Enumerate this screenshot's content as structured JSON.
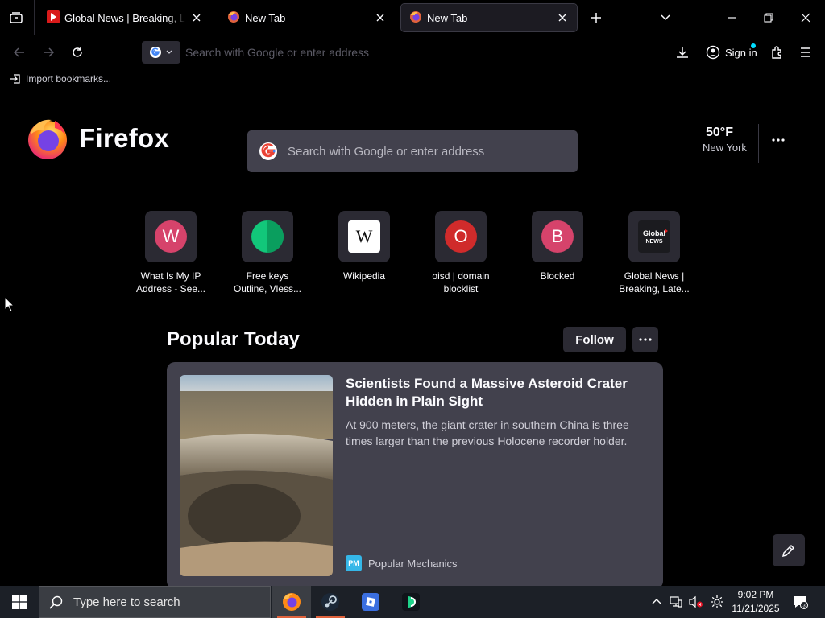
{
  "tabs": [
    {
      "title": "Global News | Breaking, Latest News",
      "selected": false,
      "favicon": "global-news-favicon"
    },
    {
      "title": "New Tab",
      "selected": false,
      "favicon": "firefox-favicon"
    },
    {
      "title": "New Tab",
      "selected": true,
      "favicon": "firefox-favicon"
    }
  ],
  "navbar": {
    "url_placeholder": "Search with Google or enter address",
    "sign_in_label": "Sign in"
  },
  "bookmarks": {
    "import_label": "Import bookmarks..."
  },
  "newtab": {
    "brand": "Firefox",
    "search_placeholder": "Search with Google or enter address",
    "weather": {
      "temp": "50°F",
      "city": "New York"
    },
    "top_sites": [
      {
        "label_line1": "What Is My IP",
        "label_line2": "Address - See...",
        "letter": "W",
        "color": "#d6436b"
      },
      {
        "label_line1": "Free keys",
        "label_line2": "Outline, Vless...",
        "letter": "",
        "color": "#12c77a"
      },
      {
        "label_line1": "Wikipedia",
        "label_line2": "",
        "letter": "W",
        "color": "#ffffff"
      },
      {
        "label_line1": "oisd | domain",
        "label_line2": "blocklist",
        "letter": "O",
        "color": "#d02b2b"
      },
      {
        "label_line1": "Blocked",
        "label_line2": "",
        "letter": "B",
        "color": "#d6436b"
      },
      {
        "label_line1": "Global News |",
        "label_line2": "Breaking, Late...",
        "letter": "Global NEWS",
        "color": "#1b1b1f"
      }
    ],
    "popular": {
      "title": "Popular Today",
      "follow_label": "Follow",
      "story": {
        "title": "Scientists Found a Massive Asteroid Crater Hidden in Plain Sight",
        "description": "At 900 meters, the giant crater in southern China is three times larger than the previous Holocene recorder holder.",
        "source": "Popular Mechanics",
        "source_logo": "PM"
      }
    }
  },
  "taskbar": {
    "search_placeholder": "Type here to search",
    "time": "9:02 PM",
    "date": "11/21/2025"
  },
  "colors": {
    "accent_firefox": "#e0623c",
    "card_bg": "#42414d",
    "tile_bg": "#2b2a33"
  }
}
